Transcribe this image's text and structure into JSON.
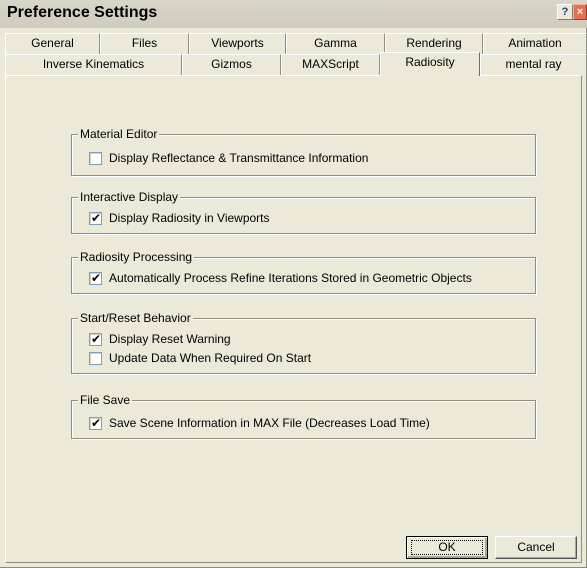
{
  "window": {
    "title": "Preference Settings",
    "help_label": "?",
    "close_label": "×"
  },
  "tabs": {
    "row1": [
      "General",
      "Files",
      "Viewports",
      "Gamma",
      "Rendering",
      "Animation"
    ],
    "row2": [
      "Inverse Kinematics",
      "Gizmos",
      "MAXScript",
      "Radiosity",
      "mental ray"
    ],
    "active": "Radiosity"
  },
  "groups": [
    {
      "title": "Material Editor",
      "options": [
        {
          "label": "Display Reflectance & Transmittance Information",
          "checked": false
        }
      ]
    },
    {
      "title": "Interactive Display",
      "options": [
        {
          "label": "Display Radiosity in Viewports",
          "checked": true
        }
      ]
    },
    {
      "title": "Radiosity Processing",
      "options": [
        {
          "label": "Automatically Process Refine Iterations Stored in Geometric Objects",
          "checked": true
        }
      ]
    },
    {
      "title": "Start/Reset Behavior",
      "options": [
        {
          "label": "Display Reset Warning",
          "checked": true
        },
        {
          "label": "Update Data When Required On Start",
          "checked": false
        }
      ]
    },
    {
      "title": "File Save",
      "options": [
        {
          "label": "Save Scene Information in MAX File (Decreases Load Time)",
          "checked": true
        }
      ]
    }
  ],
  "buttons": {
    "ok": "OK",
    "cancel": "Cancel"
  },
  "check_glyph": "✔"
}
